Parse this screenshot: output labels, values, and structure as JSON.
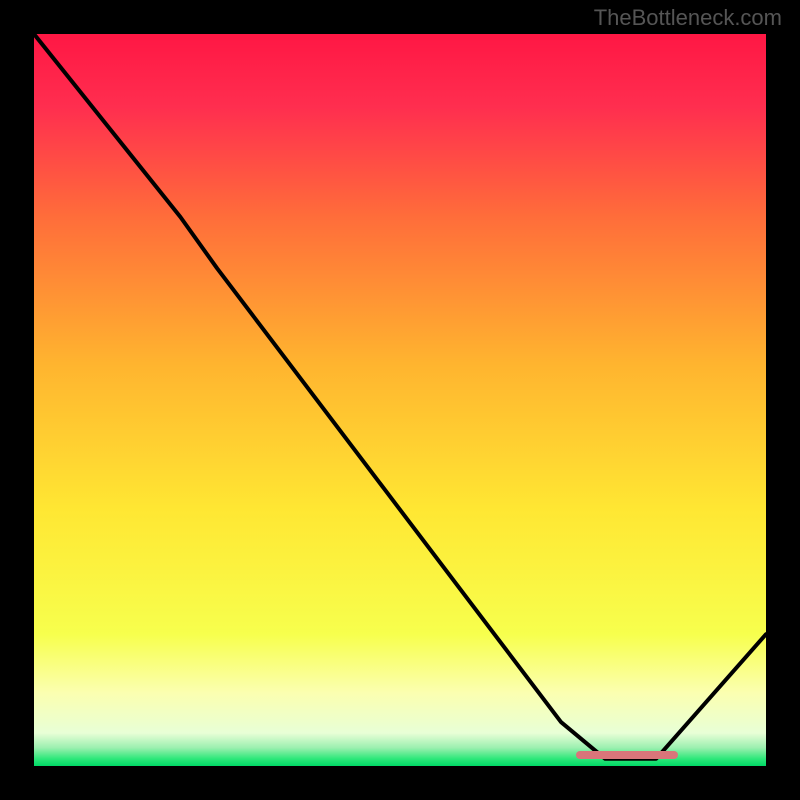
{
  "watermark": "TheBottleneck.com",
  "chart_data": {
    "type": "line",
    "title": "",
    "xlabel": "",
    "ylabel": "",
    "xlim": [
      0,
      100
    ],
    "ylim": [
      0,
      100
    ],
    "gradient_stops": [
      {
        "pos": 0.0,
        "color": "#ff1744"
      },
      {
        "pos": 0.1,
        "color": "#ff2e4f"
      },
      {
        "pos": 0.25,
        "color": "#ff6d3a"
      },
      {
        "pos": 0.45,
        "color": "#ffb42f"
      },
      {
        "pos": 0.65,
        "color": "#ffe733"
      },
      {
        "pos": 0.82,
        "color": "#f7ff4d"
      },
      {
        "pos": 0.9,
        "color": "#fbffb0"
      },
      {
        "pos": 0.955,
        "color": "#e8ffd6"
      },
      {
        "pos": 0.975,
        "color": "#9cf0b0"
      },
      {
        "pos": 0.99,
        "color": "#2ee87a"
      },
      {
        "pos": 1.0,
        "color": "#00d966"
      }
    ],
    "curve_points": [
      {
        "x": 0,
        "y": 100
      },
      {
        "x": 20,
        "y": 75
      },
      {
        "x": 25,
        "y": 68
      },
      {
        "x": 72,
        "y": 6
      },
      {
        "x": 78,
        "y": 1
      },
      {
        "x": 85,
        "y": 1
      },
      {
        "x": 100,
        "y": 18
      }
    ],
    "marker": {
      "x_start": 74,
      "x_end": 88,
      "y": 1.5,
      "color": "#d9757a"
    }
  }
}
